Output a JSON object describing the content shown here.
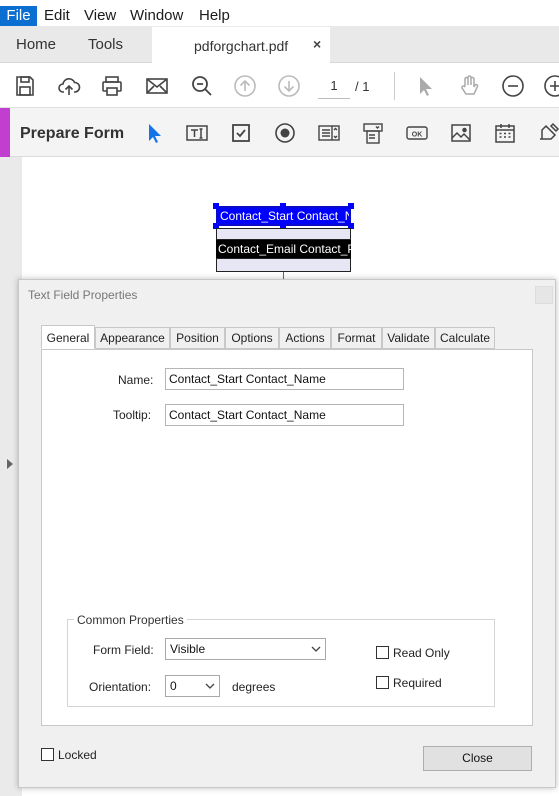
{
  "menu": {
    "items": [
      "File",
      "Edit",
      "View",
      "Window",
      "Help"
    ]
  },
  "tabs_bar": {
    "home": "Home",
    "tools": "Tools",
    "document": "pdforgchart.pdf",
    "close_glyph": "×"
  },
  "toolbar": {
    "current_page": "1",
    "total_pages": "/ 1"
  },
  "prepare_form": {
    "title": "Prepare Form",
    "accent_color": "#c23ed1"
  },
  "document": {
    "field1_text": "Contact_Start Contact_Name",
    "field2_text": "Contact_Email Contact_Phone",
    "selection_color": "#0000ff"
  },
  "dialog": {
    "title": "Text Field Properties",
    "tabs": [
      "General",
      "Appearance",
      "Position",
      "Options",
      "Actions",
      "Format",
      "Validate",
      "Calculate"
    ],
    "selected_tab": "General",
    "name_label": "Name:",
    "name_value": "Contact_Start Contact_Name",
    "tooltip_label": "Tooltip:",
    "tooltip_value": "Contact_Start Contact_Name",
    "common_properties": "Common Properties",
    "form_field_label": "Form Field:",
    "form_field_value": "Visible",
    "orientation_label": "Orientation:",
    "orientation_value": "0",
    "degrees_label": "degrees",
    "read_only_label": "Read Only",
    "required_label": "Required",
    "locked_label": "Locked",
    "close_button": "Close"
  }
}
